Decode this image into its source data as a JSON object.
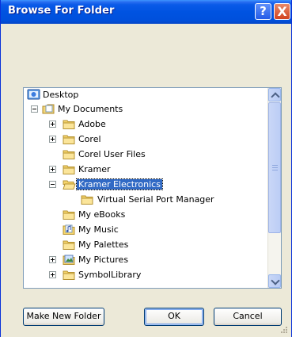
{
  "window": {
    "title": "Browse For Folder",
    "help_glyph": "?",
    "close_glyph": "X"
  },
  "tree": {
    "items": [
      {
        "label": "Desktop",
        "icon": "desktop-icon",
        "expander": "none"
      },
      {
        "label": "My Documents",
        "icon": "my-documents-icon",
        "expander": "minus"
      },
      {
        "label": "Adobe",
        "icon": "folder-icon",
        "expander": "plus"
      },
      {
        "label": "Corel",
        "icon": "folder-icon",
        "expander": "plus"
      },
      {
        "label": "Corel User Files",
        "icon": "folder-icon",
        "expander": "none"
      },
      {
        "label": "Kramer",
        "icon": "folder-icon",
        "expander": "plus"
      },
      {
        "label": "Kramer Electronics",
        "icon": "folder-open-icon",
        "expander": "minus",
        "selected": true
      },
      {
        "label": "Virtual Serial Port Manager",
        "icon": "folder-icon",
        "expander": "none"
      },
      {
        "label": "My eBooks",
        "icon": "folder-icon",
        "expander": "none"
      },
      {
        "label": "My Music",
        "icon": "music-folder-icon",
        "expander": "none"
      },
      {
        "label": "My Palettes",
        "icon": "folder-icon",
        "expander": "none"
      },
      {
        "label": "My Pictures",
        "icon": "pictures-folder-icon",
        "expander": "plus"
      },
      {
        "label": "SymbolLibrary",
        "icon": "folder-icon",
        "expander": "plus"
      }
    ]
  },
  "buttons": {
    "new_folder": "Make New Folder",
    "ok": "OK",
    "cancel": "Cancel"
  },
  "colors": {
    "title_bar": "#0053e1",
    "selection": "#316ac5",
    "dialog_bg": "#ece9d8"
  }
}
